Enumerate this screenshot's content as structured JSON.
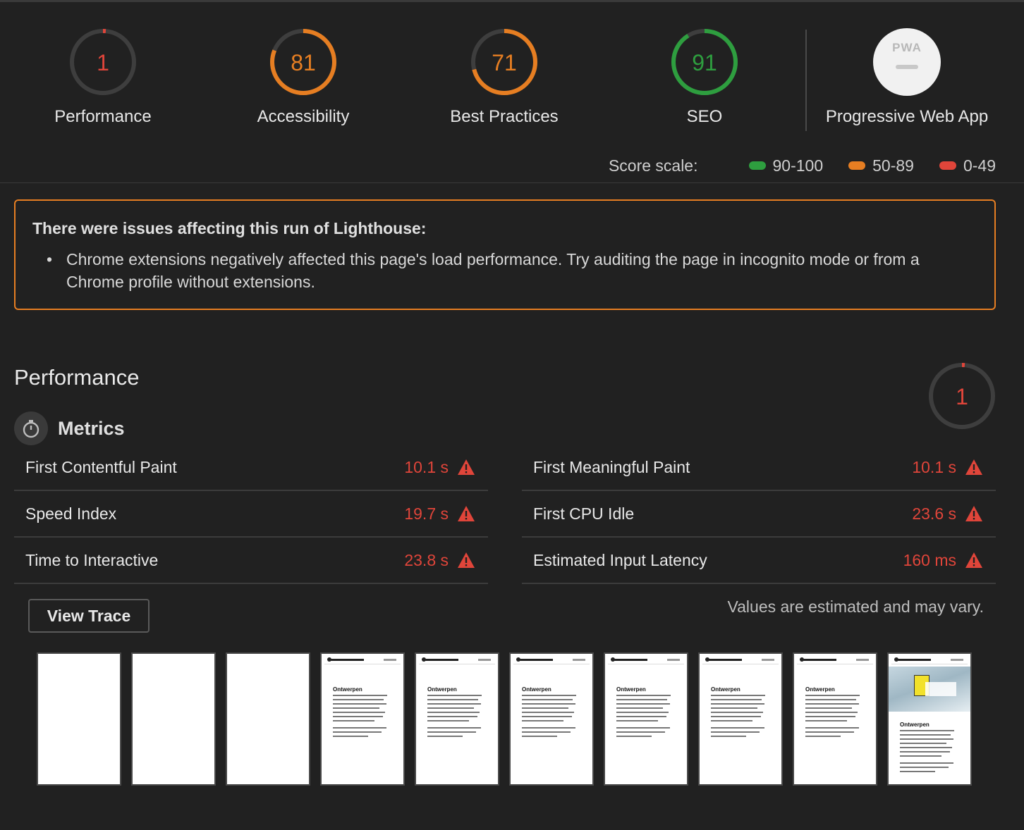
{
  "gauges": [
    {
      "score": "1",
      "value": 1,
      "label": "Performance",
      "color": "#e0453a"
    },
    {
      "score": "81",
      "value": 81,
      "label": "Accessibility",
      "color": "#e67e22"
    },
    {
      "score": "71",
      "value": 71,
      "label": "Best Practices",
      "color": "#e67e22"
    },
    {
      "score": "91",
      "value": 91,
      "label": "SEO",
      "color": "#2e9e3f"
    }
  ],
  "pwa": {
    "badge_text": "PWA",
    "label": "Progressive Web App"
  },
  "score_scale": {
    "title": "Score scale:",
    "items": [
      {
        "label": "90-100",
        "color": "#2e9e3f"
      },
      {
        "label": "50-89",
        "color": "#e67e22"
      },
      {
        "label": "0-49",
        "color": "#e0453a"
      }
    ]
  },
  "warning": {
    "title": "There were issues affecting this run of Lighthouse:",
    "items": [
      "Chrome extensions negatively affected this page's load performance. Try auditing the page in incognito mode or from a Chrome profile without extensions."
    ],
    "border_color": "#e67e22"
  },
  "performance": {
    "title": "Performance",
    "score": "1",
    "score_value": 1,
    "metrics_title": "Metrics",
    "metrics_icon": "stopwatch-icon",
    "metrics": [
      {
        "label": "First Contentful Paint",
        "value": "10.1 s"
      },
      {
        "label": "First Meaningful Paint",
        "value": "10.1 s"
      },
      {
        "label": "Speed Index",
        "value": "19.7 s"
      },
      {
        "label": "First CPU Idle",
        "value": "23.6 s"
      },
      {
        "label": "Time to Interactive",
        "value": "23.8 s"
      },
      {
        "label": "Estimated Input Latency",
        "value": "160 ms"
      }
    ],
    "fail_color": "#e0453a",
    "view_trace_label": "View Trace",
    "estimate_note": "Values are estimated and may vary."
  },
  "filmstrip": {
    "frames": [
      "blank",
      "blank",
      "blank",
      "text",
      "text",
      "text",
      "text",
      "text",
      "text",
      "hero"
    ],
    "frame_heading": "Ontwerpen"
  }
}
